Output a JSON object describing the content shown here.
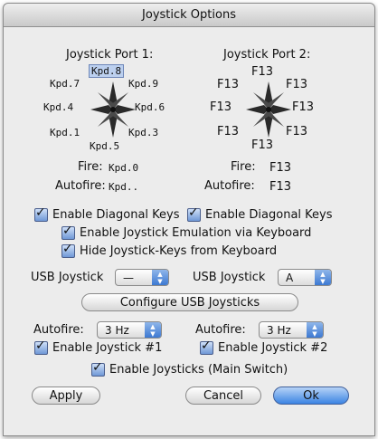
{
  "window": {
    "title": "Joystick Options"
  },
  "port1": {
    "title": "Joystick Port 1:",
    "up": "Kpd.8",
    "up_left": "Kpd.7",
    "up_right": "Kpd.9",
    "left": "Kpd.4",
    "right": "Kpd.6",
    "down_left": "Kpd.1",
    "down_right": "Kpd.3",
    "down": "Kpd.5",
    "fire_label": "Fire:",
    "fire": "Kpd.0",
    "autofire_label": "Autofire:",
    "autofire": "Kpd.."
  },
  "port2": {
    "title": "Joystick Port 2:",
    "up": "F13",
    "up_left": "F13",
    "up_right": "F13",
    "left": "F13",
    "right": "F13",
    "down_left": "F13",
    "down_right": "F13",
    "down": "F13",
    "fire_label": "Fire:",
    "fire": "F13",
    "autofire_label": "Autofire:",
    "autofire": "F13"
  },
  "options": {
    "diag1": "Enable Diagonal Keys",
    "diag2": "Enable Diagonal Keys",
    "emulation": "Enable Joystick Emulation via Keyboard",
    "hide_keys": "Hide Joystick-Keys from Keyboard"
  },
  "usb": {
    "label1": "USB Joystick",
    "value1": "—",
    "label2": "USB Joystick",
    "value2": "A",
    "configure": "Configure USB Joysticks"
  },
  "autofire": {
    "label1": "Autofire:",
    "value1": "3 Hz",
    "label2": "Autofire:",
    "value2": "3 Hz",
    "enable1": "Enable Joystick #1",
    "enable2": "Enable Joystick #2",
    "main_switch": "Enable Joysticks (Main Switch)"
  },
  "buttons": {
    "apply": "Apply",
    "cancel": "Cancel",
    "ok": "Ok"
  }
}
